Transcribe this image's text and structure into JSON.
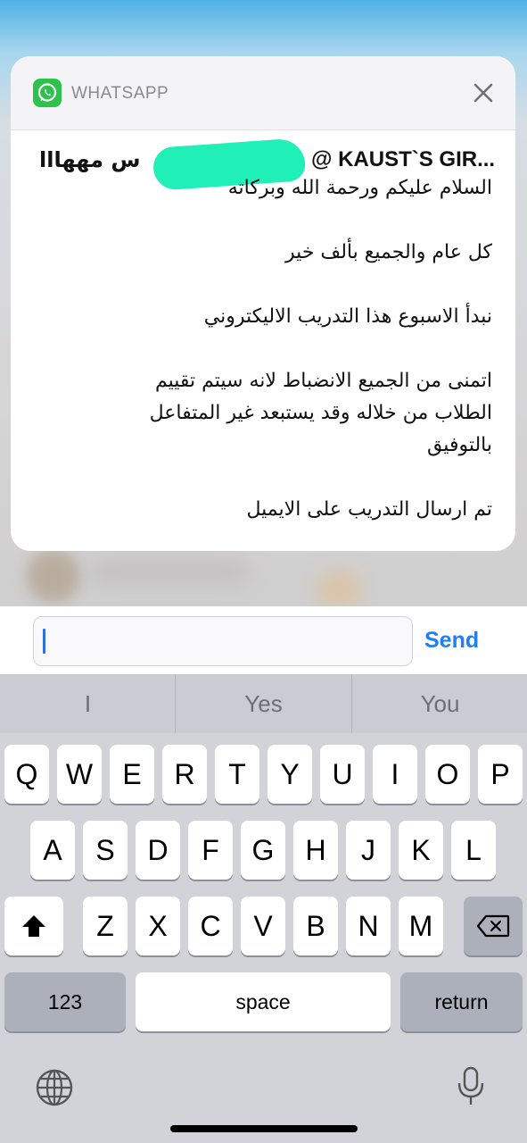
{
  "notification": {
    "app_name": "WHATSAPP",
    "title_left": "س مههااا",
    "title_right": "@ KAUST`S GIR...",
    "message_lines": [
      "السلام عليكم ورحمة الله وبركاته",
      "",
      "كل عام والجميع بألف خير",
      "",
      "نبدأ الاسبوع هذا التدريب الاليكتروني",
      "",
      "اتمنى من الجميع الانضباط لانه سيتم تقييم",
      "الطلاب من خلاله وقد يستبعد غير المتفاعل",
      "بالتوفيق",
      "",
      "تم ارسال التدريب على الايميل"
    ]
  },
  "reply": {
    "input_value": "",
    "send_label": "Send"
  },
  "keyboard": {
    "suggestions": [
      "I",
      "Yes",
      "You"
    ],
    "row1": [
      "Q",
      "W",
      "E",
      "R",
      "T",
      "Y",
      "U",
      "I",
      "O",
      "P"
    ],
    "row2": [
      "A",
      "S",
      "D",
      "F",
      "G",
      "H",
      "J",
      "K",
      "L"
    ],
    "row3": [
      "Z",
      "X",
      "C",
      "V",
      "B",
      "N",
      "M"
    ],
    "numbers_label": "123",
    "space_label": "space",
    "return_label": "return"
  },
  "colors": {
    "whatsapp_green": "#2cc24b",
    "send_blue": "#1f7ff5",
    "caret_blue": "#2f6fe4"
  },
  "icons": [
    "whatsapp-icon",
    "close-icon",
    "shift-icon",
    "backspace-icon",
    "globe-icon",
    "microphone-icon"
  ]
}
